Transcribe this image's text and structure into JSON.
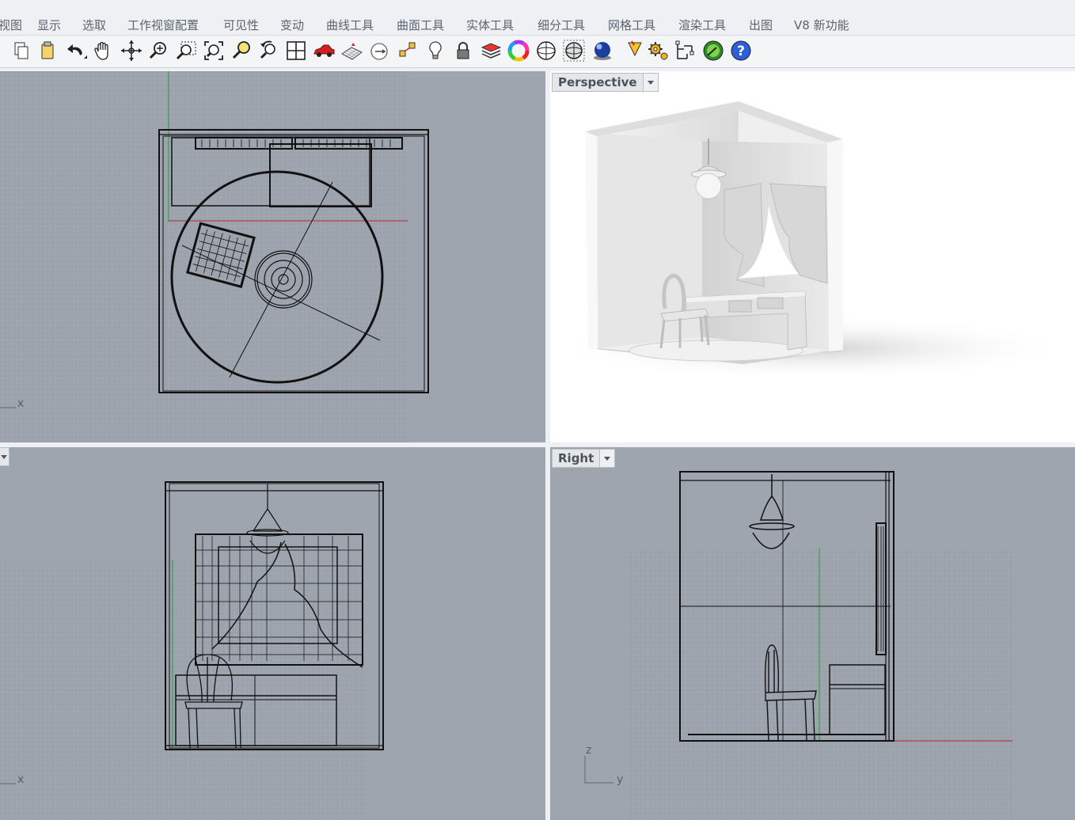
{
  "menu": {
    "items": [
      "视图",
      "显示",
      "选取",
      "工作视窗配置",
      "可见性",
      "变动",
      "曲线工具",
      "曲面工具",
      "实体工具",
      "细分工具",
      "网格工具",
      "渲染工具",
      "出图",
      "V8 新功能"
    ]
  },
  "toolbar": {
    "icons": [
      "copy-icon",
      "paste-icon",
      "undo-icon",
      "pan-hand-icon",
      "rotate-view-icon",
      "zoom-icon",
      "zoom-window-icon",
      "zoom-extents-icon",
      "zoom-selected-icon",
      "undo-view-icon",
      "four-viewports-icon",
      "car-icon",
      "ground-plane-icon",
      "cplane-icon",
      "gumball-icon",
      "light-bulb-icon",
      "lock-icon",
      "layer-icon",
      "color-wheel-icon",
      "wireframe-sphere-icon",
      "shaded-sphere-icon",
      "rendered-sphere-icon",
      "render-icon",
      "gear-icon",
      "dimension-icon",
      "environment-icon",
      "help-icon"
    ]
  },
  "viewports": {
    "top": {
      "x_axis_label": "x"
    },
    "perspective": {
      "label": "Perspective"
    },
    "front": {
      "x_axis_label": "x"
    },
    "right": {
      "label": "Right",
      "z_axis_label": "z",
      "y_axis_label": "y"
    }
  },
  "colors": {
    "viewport_bg": "#9ea5ae",
    "grid_minor": "#8f969f",
    "grid_major": "#7f868f",
    "x_axis": "#b3262a",
    "y_axis": "#1f9e3a",
    "wire": "#111111"
  }
}
